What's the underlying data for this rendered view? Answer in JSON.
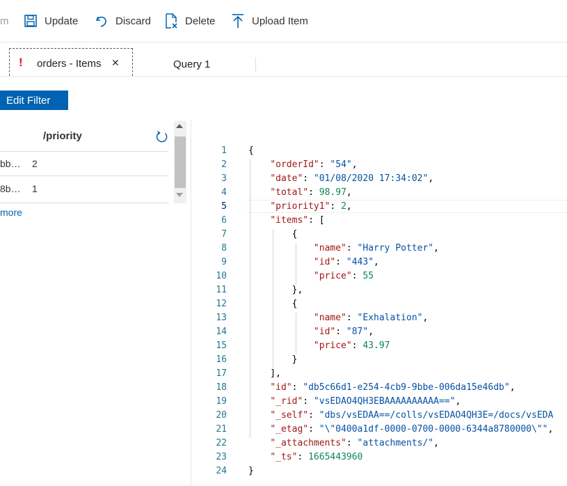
{
  "toolbar": {
    "partial_label": "m",
    "update_label": "Update",
    "discard_label": "Discard",
    "delete_label": "Delete",
    "upload_label": "Upload Item"
  },
  "tabs": {
    "active": {
      "alert": "!",
      "label": "orders - Items",
      "close": "✕"
    },
    "second": {
      "label": "Query 1"
    }
  },
  "filter": {
    "label": "Edit Filter"
  },
  "list": {
    "column_header": "/priority",
    "rows": [
      {
        "id": "bb…",
        "priority": "2"
      },
      {
        "id": "8b…",
        "priority": "1"
      }
    ],
    "load_more": "more"
  },
  "editor": {
    "line_numbers": [
      "1",
      "2",
      "3",
      "4",
      "5",
      "6",
      "7",
      "8",
      "9",
      "10",
      "11",
      "12",
      "13",
      "14",
      "15",
      "16",
      "17",
      "18",
      "19",
      "20",
      "21",
      "22",
      "23",
      "24"
    ],
    "lines": [
      [
        {
          "t": "{",
          "c": "p"
        }
      ],
      [
        {
          "t": "    ",
          "c": "p"
        },
        {
          "t": "\"orderId\"",
          "c": "k"
        },
        {
          "t": ": ",
          "c": "p"
        },
        {
          "t": "\"54\"",
          "c": "s"
        },
        {
          "t": ",",
          "c": "p"
        }
      ],
      [
        {
          "t": "    ",
          "c": "p"
        },
        {
          "t": "\"date\"",
          "c": "k"
        },
        {
          "t": ": ",
          "c": "p"
        },
        {
          "t": "\"01/08/2020 17:34:02\"",
          "c": "s"
        },
        {
          "t": ",",
          "c": "p"
        }
      ],
      [
        {
          "t": "    ",
          "c": "p"
        },
        {
          "t": "\"total\"",
          "c": "k"
        },
        {
          "t": ": ",
          "c": "p"
        },
        {
          "t": "98.97",
          "c": "n"
        },
        {
          "t": ",",
          "c": "p"
        }
      ],
      [
        {
          "t": "    ",
          "c": "p"
        },
        {
          "t": "\"priority1\"",
          "c": "k"
        },
        {
          "t": ": ",
          "c": "p"
        },
        {
          "t": "2",
          "c": "n"
        },
        {
          "t": ",",
          "c": "p"
        }
      ],
      [
        {
          "t": "    ",
          "c": "p"
        },
        {
          "t": "\"items\"",
          "c": "k"
        },
        {
          "t": ": [",
          "c": "p"
        }
      ],
      [
        {
          "t": "        {",
          "c": "p"
        }
      ],
      [
        {
          "t": "            ",
          "c": "p"
        },
        {
          "t": "\"name\"",
          "c": "k"
        },
        {
          "t": ": ",
          "c": "p"
        },
        {
          "t": "\"Harry Potter\"",
          "c": "s"
        },
        {
          "t": ",",
          "c": "p"
        }
      ],
      [
        {
          "t": "            ",
          "c": "p"
        },
        {
          "t": "\"id\"",
          "c": "k"
        },
        {
          "t": ": ",
          "c": "p"
        },
        {
          "t": "\"443\"",
          "c": "s"
        },
        {
          "t": ",",
          "c": "p"
        }
      ],
      [
        {
          "t": "            ",
          "c": "p"
        },
        {
          "t": "\"price\"",
          "c": "k"
        },
        {
          "t": ": ",
          "c": "p"
        },
        {
          "t": "55",
          "c": "n"
        }
      ],
      [
        {
          "t": "        },",
          "c": "p"
        }
      ],
      [
        {
          "t": "        {",
          "c": "p"
        }
      ],
      [
        {
          "t": "            ",
          "c": "p"
        },
        {
          "t": "\"name\"",
          "c": "k"
        },
        {
          "t": ": ",
          "c": "p"
        },
        {
          "t": "\"Exhalation\"",
          "c": "s"
        },
        {
          "t": ",",
          "c": "p"
        }
      ],
      [
        {
          "t": "            ",
          "c": "p"
        },
        {
          "t": "\"id\"",
          "c": "k"
        },
        {
          "t": ": ",
          "c": "p"
        },
        {
          "t": "\"87\"",
          "c": "s"
        },
        {
          "t": ",",
          "c": "p"
        }
      ],
      [
        {
          "t": "            ",
          "c": "p"
        },
        {
          "t": "\"price\"",
          "c": "k"
        },
        {
          "t": ": ",
          "c": "p"
        },
        {
          "t": "43.97",
          "c": "n"
        }
      ],
      [
        {
          "t": "        }",
          "c": "p"
        }
      ],
      [
        {
          "t": "    ],",
          "c": "p"
        }
      ],
      [
        {
          "t": "    ",
          "c": "p"
        },
        {
          "t": "\"id\"",
          "c": "k"
        },
        {
          "t": ": ",
          "c": "p"
        },
        {
          "t": "\"db5c66d1-e254-4cb9-9bbe-006da15e46db\"",
          "c": "s"
        },
        {
          "t": ",",
          "c": "p"
        }
      ],
      [
        {
          "t": "    ",
          "c": "p"
        },
        {
          "t": "\"_rid\"",
          "c": "k"
        },
        {
          "t": ": ",
          "c": "p"
        },
        {
          "t": "\"vsEDAO4QH3EBAAAAAAAAAA==\"",
          "c": "s"
        },
        {
          "t": ",",
          "c": "p"
        }
      ],
      [
        {
          "t": "    ",
          "c": "p"
        },
        {
          "t": "\"_self\"",
          "c": "k"
        },
        {
          "t": ": ",
          "c": "p"
        },
        {
          "t": "\"dbs/vsEDAA==/colls/vsEDAO4QH3E=/docs/vsEDA",
          "c": "s"
        }
      ],
      [
        {
          "t": "    ",
          "c": "p"
        },
        {
          "t": "\"_etag\"",
          "c": "k"
        },
        {
          "t": ": ",
          "c": "p"
        },
        {
          "t": "\"\\\"0400a1df-0000-0700-0000-6344a8780000\\\"\"",
          "c": "s"
        },
        {
          "t": ",",
          "c": "p"
        }
      ],
      [
        {
          "t": "    ",
          "c": "p"
        },
        {
          "t": "\"_attachments\"",
          "c": "k"
        },
        {
          "t": ": ",
          "c": "p"
        },
        {
          "t": "\"attachments/\"",
          "c": "s"
        },
        {
          "t": ",",
          "c": "p"
        }
      ],
      [
        {
          "t": "    ",
          "c": "p"
        },
        {
          "t": "\"_ts\"",
          "c": "k"
        },
        {
          "t": ": ",
          "c": "p"
        },
        {
          "t": "1665443960",
          "c": "n"
        }
      ],
      [
        {
          "t": "}",
          "c": "p"
        }
      ]
    ],
    "colors": {
      "key": "#a31515",
      "string": "#0451a5",
      "number": "#098658",
      "line_number": "#237893"
    }
  },
  "colors": {
    "accent": "#0063b1",
    "alert": "#e81123"
  }
}
